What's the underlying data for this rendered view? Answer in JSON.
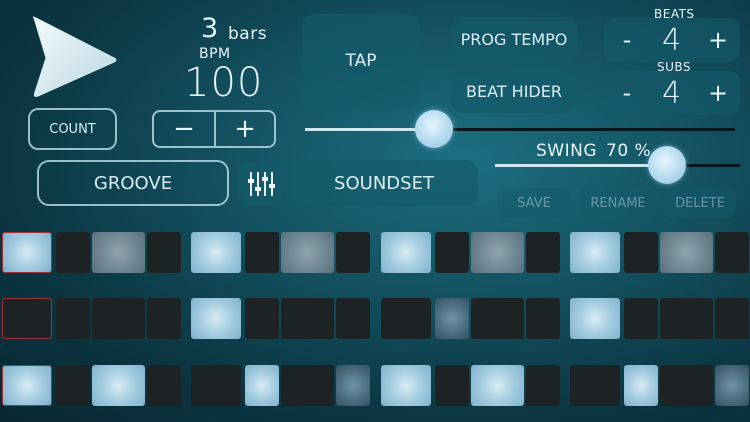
{
  "bars": {
    "value": "3",
    "unit": "bars"
  },
  "tempo": {
    "label": "BPM",
    "value": "100",
    "minus": "−",
    "plus": "+"
  },
  "buttons": {
    "count": "COUNT",
    "tap": "TAP",
    "prog_tempo": "PROG TEMPO",
    "beat_hider": "BEAT HIDER",
    "groove": "GROOVE",
    "soundset": "SOUNDSET",
    "save": "SAVE",
    "rename": "RENAME",
    "delete": "DELETE"
  },
  "beats": {
    "label": "BEATS",
    "value": "4",
    "minus": "-",
    "plus": "+"
  },
  "subs": {
    "label": "SUBS",
    "value": "4",
    "minus": "-",
    "plus": "+"
  },
  "swing": {
    "label": "SWING",
    "value": "70 %",
    "level": 0.7
  },
  "tempo_slider": {
    "level": 0.3
  },
  "icons": {
    "play": "play-icon",
    "mixer": "mixer-sliders-icon"
  },
  "colors": {
    "accent": "#a9cfe2",
    "pad_off": "#1d2225",
    "highlight_border": "#a0303a"
  },
  "grid": {
    "rows": [
      [
        "on",
        "off",
        "mid",
        "off",
        "on",
        "off",
        "mid",
        "off",
        "on",
        "off",
        "mid",
        "off",
        "on",
        "off",
        "mid",
        "off"
      ],
      [
        "off",
        "off",
        "off",
        "off",
        "on",
        "off",
        "off",
        "off",
        "off",
        "dim",
        "off",
        "off",
        "on",
        "off",
        "off",
        "off"
      ],
      [
        "on",
        "off",
        "on",
        "off",
        "off",
        "on",
        "off",
        "dim",
        "on",
        "off",
        "on",
        "off",
        "off",
        "on",
        "off",
        "dim"
      ]
    ],
    "highlight_column": 0
  }
}
